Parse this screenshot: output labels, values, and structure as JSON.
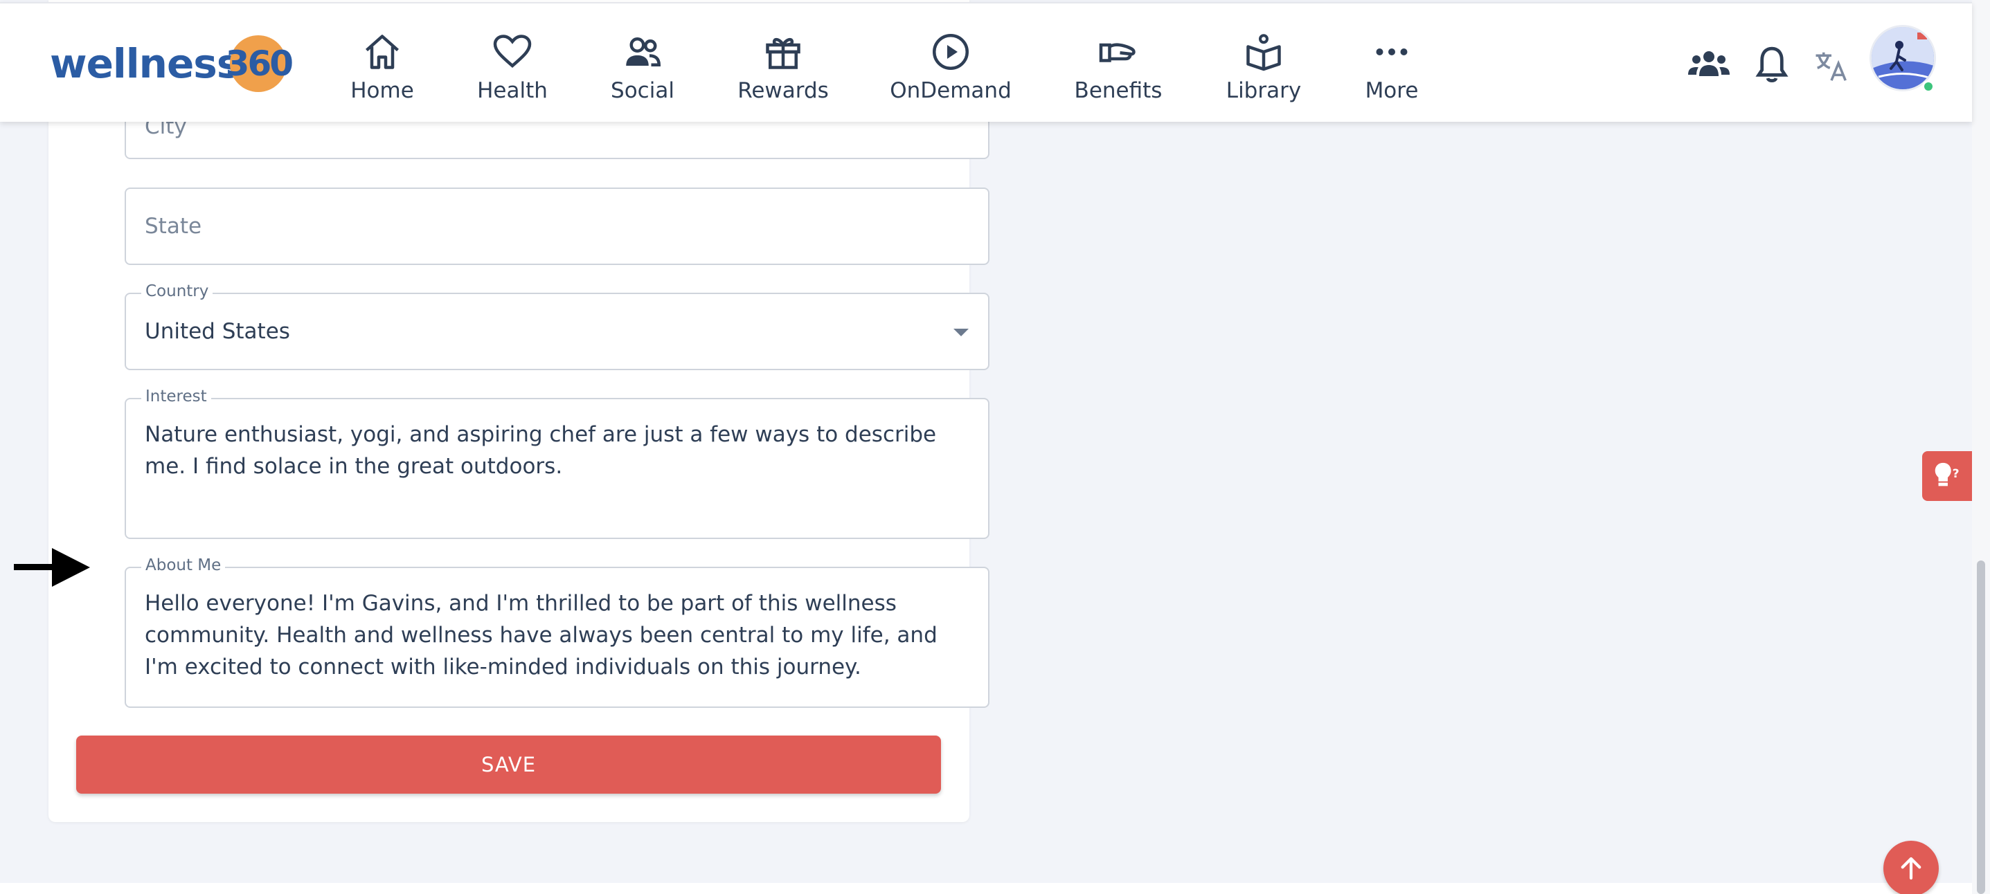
{
  "header": {
    "logo_text": "wellness",
    "logo_number": "360",
    "nav": [
      {
        "label": "Home",
        "icon": "home-icon"
      },
      {
        "label": "Health",
        "icon": "heart-icon"
      },
      {
        "label": "Social",
        "icon": "people-icon"
      },
      {
        "label": "Rewards",
        "icon": "gift-icon"
      },
      {
        "label": "OnDemand",
        "icon": "play-circle-icon"
      },
      {
        "label": "Benefits",
        "icon": "hand-icon"
      },
      {
        "label": "Library",
        "icon": "book-icon"
      },
      {
        "label": "More",
        "icon": "ellipsis-icon"
      }
    ],
    "actions": [
      "group-icon",
      "bell-icon",
      "translate-icon",
      "avatar"
    ]
  },
  "form": {
    "city": {
      "placeholder": "City"
    },
    "state": {
      "placeholder": "State"
    },
    "country": {
      "label": "Country",
      "value": "United States"
    },
    "interest": {
      "label": "Interest",
      "value": "Nature enthusiast, yogi, and aspiring chef are just a few ways to describe me. I find solace in the great outdoors."
    },
    "about_me": {
      "label": "About Me",
      "value": "Hello everyone! I'm Gavins, and I'm thrilled to be part of this wellness community. Health and wellness have always been central to my life, and I'm excited to connect with like-minded individuals on this journey."
    },
    "save_label": "SAVE"
  },
  "widgets": {
    "tips_icon": "lightbulb-question-icon",
    "scroll_top_icon": "arrow-up-icon"
  },
  "colors": {
    "accent": "#e05c56",
    "brand_blue": "#2b5ca4",
    "brand_orange": "#f0a04b",
    "nav_text": "#2e3e55",
    "page_bg": "#f2f4f9"
  }
}
